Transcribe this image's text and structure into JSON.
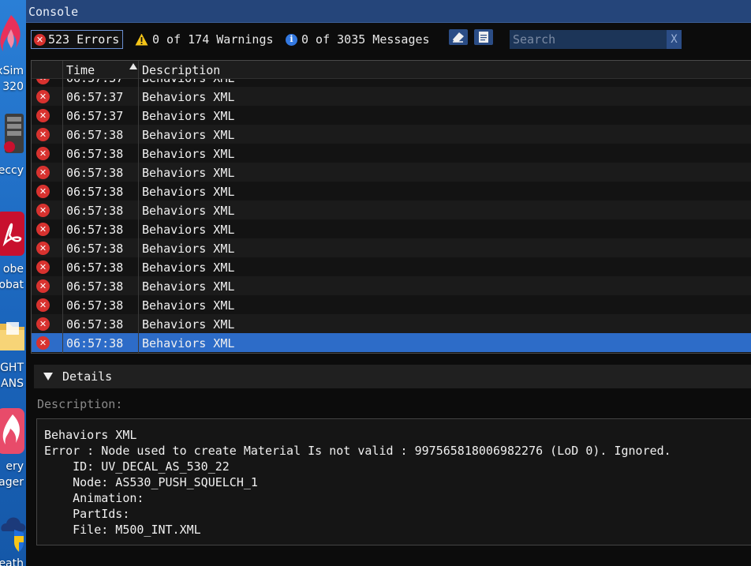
{
  "desktop": {
    "labels": [
      "xSim",
      "320",
      "eccy",
      "obe",
      "obat",
      "IGHT",
      "ANS",
      "ery",
      "nager",
      "Veath"
    ]
  },
  "window": {
    "title": "Console"
  },
  "toolbar": {
    "errors": "523 Errors",
    "warnings": "0 of 174 Warnings",
    "messages": "0 of 3035 Messages",
    "search_placeholder": "Search",
    "search_clear": "X",
    "clear_icon": "eraser-icon",
    "copy_icon": "copy-icon"
  },
  "table": {
    "headers": {
      "time": "Time",
      "description": "Description"
    },
    "sort": "ascending",
    "partial_row": {
      "time": "06:57:37",
      "description": "Behaviors XML"
    },
    "rows": [
      {
        "time": "06:57:37",
        "description": "Behaviors XML"
      },
      {
        "time": "06:57:37",
        "description": "Behaviors XML"
      },
      {
        "time": "06:57:38",
        "description": "Behaviors XML"
      },
      {
        "time": "06:57:38",
        "description": "Behaviors XML"
      },
      {
        "time": "06:57:38",
        "description": "Behaviors XML"
      },
      {
        "time": "06:57:38",
        "description": "Behaviors XML"
      },
      {
        "time": "06:57:38",
        "description": "Behaviors XML"
      },
      {
        "time": "06:57:38",
        "description": "Behaviors XML"
      },
      {
        "time": "06:57:38",
        "description": "Behaviors XML"
      },
      {
        "time": "06:57:38",
        "description": "Behaviors XML"
      },
      {
        "time": "06:57:38",
        "description": "Behaviors XML"
      },
      {
        "time": "06:57:38",
        "description": "Behaviors XML"
      },
      {
        "time": "06:57:38",
        "description": "Behaviors XML"
      },
      {
        "time": "06:57:38",
        "description": "Behaviors XML"
      }
    ],
    "selected_index": 13
  },
  "details": {
    "title": "Details",
    "description_label": "Description:",
    "lines": [
      "Behaviors XML",
      "Error : Node used to create Material Is not valid : 997565818006982276 (LoD 0). Ignored.",
      "    ID: UV_DECAL_AS_530_22",
      "    Node: AS530_PUSH_SQUELCH_1",
      "    Animation:",
      "    PartIds:",
      "    File: M500_INT.XML"
    ]
  },
  "colors": {
    "titlebar": "#25457a",
    "selection": "#2d6cc8",
    "error": "#d8322f",
    "warning": "#f5c518",
    "info": "#3378e0"
  }
}
